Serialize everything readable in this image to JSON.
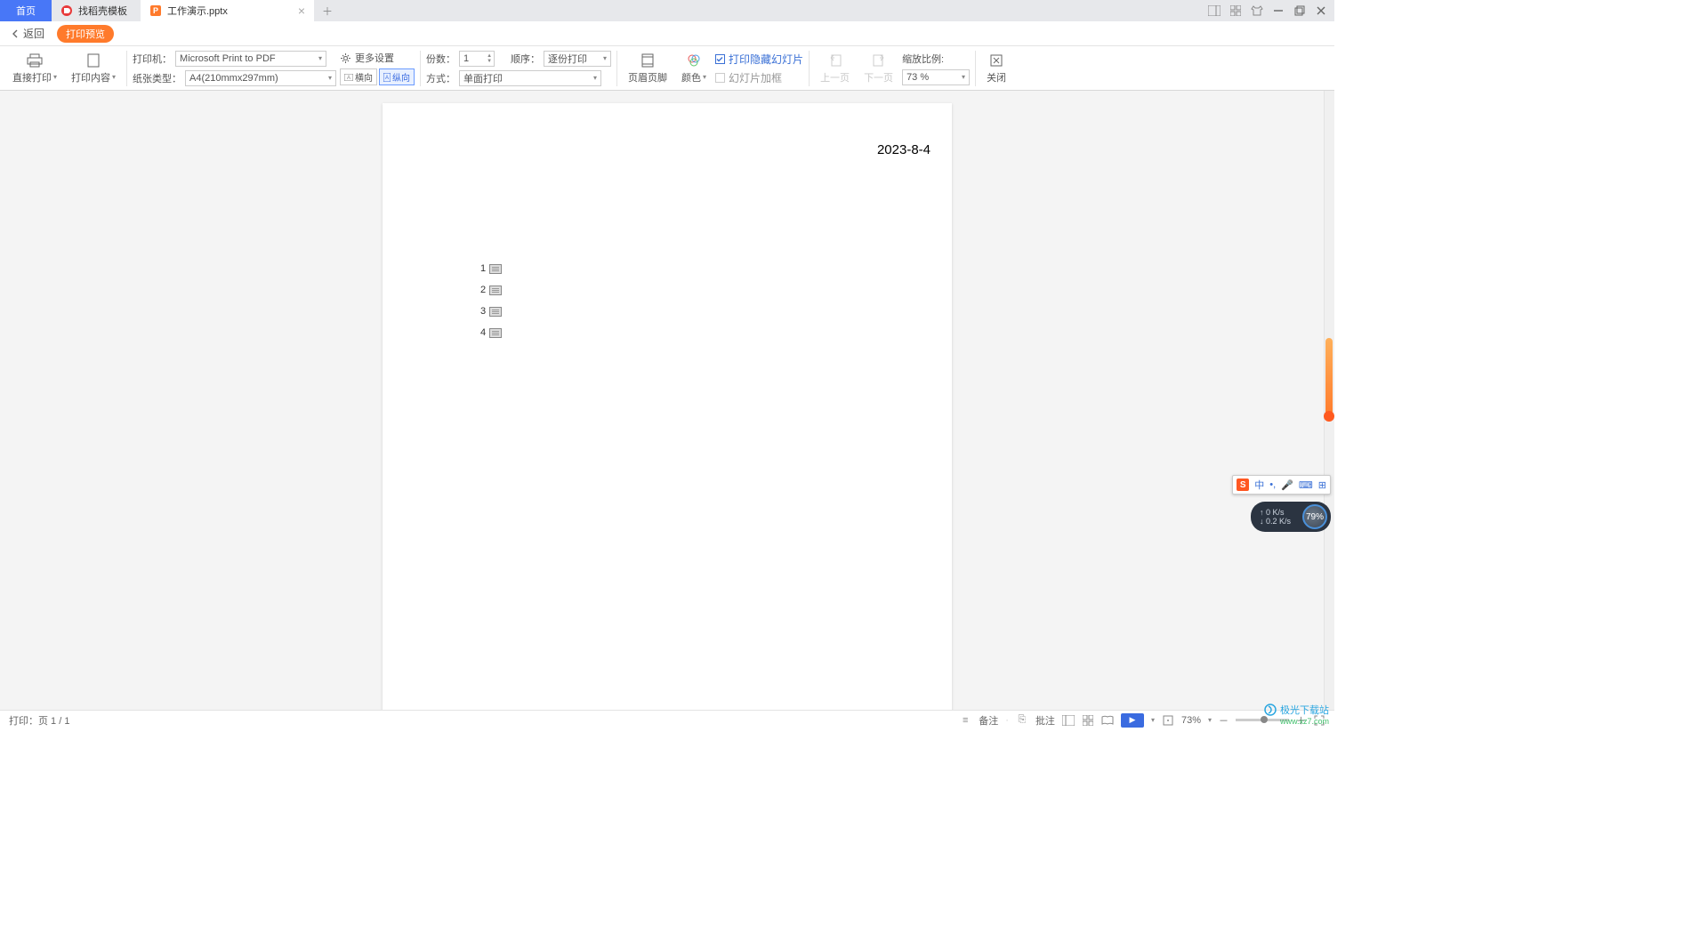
{
  "tabs": {
    "home": "首页",
    "template": "找稻壳模板",
    "active_file": "工作演示.pptx"
  },
  "backrow": {
    "back": "返回",
    "preview": "打印预览"
  },
  "ribbon": {
    "direct_print": "直接打印",
    "print_content": "打印内容",
    "printer_label": "打印机：",
    "printer_value": "Microsoft Print to PDF",
    "paper_label": "纸张类型：",
    "paper_value": "A4(210mmx297mm)",
    "more_settings": "更多设置",
    "orient_h": "横向",
    "orient_v": "纵向",
    "copies_label": "份数：",
    "copies_value": "1",
    "order_label": "顺序：",
    "order_value": "逐份打印",
    "mode_label": "方式：",
    "mode_value": "单面打印",
    "header_footer": "页眉页脚",
    "color": "颜色",
    "print_hidden": "打印隐藏幻灯片",
    "slide_frame": "幻灯片加框",
    "prev_page": "上一页",
    "next_page": "下一页",
    "zoom_label": "缩放比例:",
    "zoom_value": "73 %",
    "close": "关闭"
  },
  "page": {
    "date": "2023-8-4",
    "items": [
      "1",
      "2",
      "3",
      "4"
    ]
  },
  "status": {
    "left": "打印：页 1 / 1",
    "notes": "备注",
    "comments": "批注",
    "zoom": "73%"
  },
  "ime": {
    "lang": "中",
    "punct": "•,",
    "kb_icons": [
      "⌨",
      "⊞",
      "⊞"
    ]
  },
  "net": {
    "up": "↑ 0 K/s",
    "down": "↓ 0.2 K/s",
    "pct": "79%"
  },
  "watermark": {
    "name": "极光下载站",
    "url": "www.xz7.com"
  }
}
